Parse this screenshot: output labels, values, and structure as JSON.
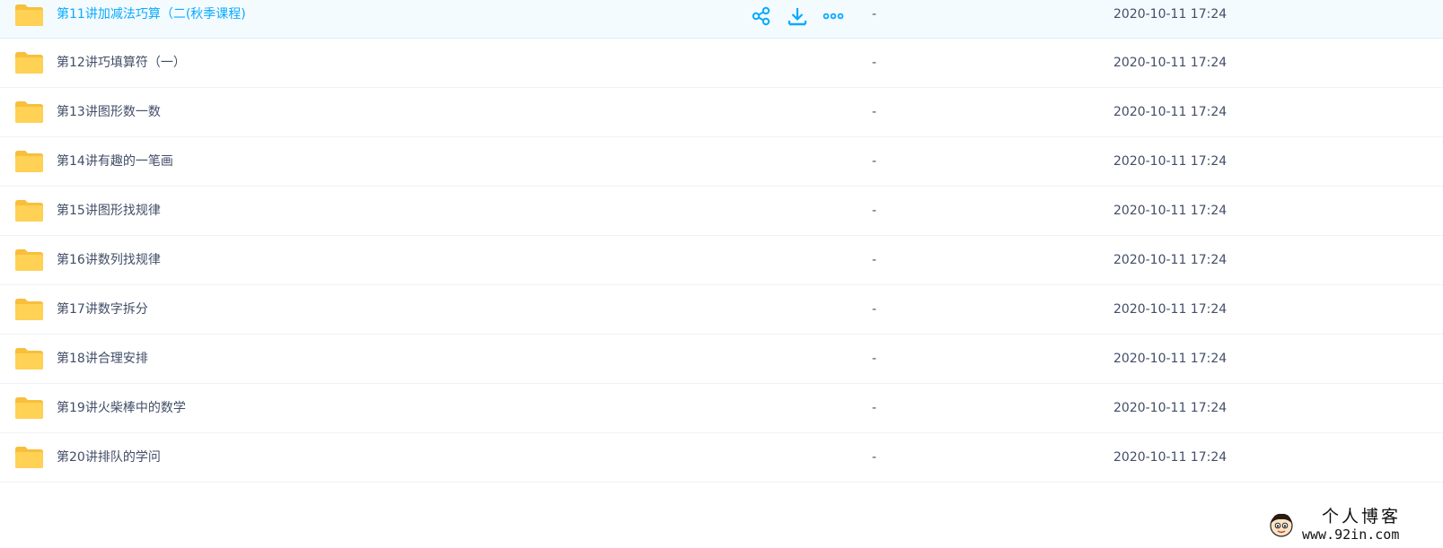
{
  "file_list": {
    "rows": [
      {
        "name": "第11讲加减法巧算（二(秋季课程)",
        "size": "-",
        "modified": "2020-10-11 17:24",
        "hovered": true
      },
      {
        "name": "第12讲巧填算符（一）",
        "size": "-",
        "modified": "2020-10-11 17:24",
        "hovered": false
      },
      {
        "name": "第13讲图形数一数",
        "size": "-",
        "modified": "2020-10-11 17:24",
        "hovered": false
      },
      {
        "name": "第14讲有趣的一笔画",
        "size": "-",
        "modified": "2020-10-11 17:24",
        "hovered": false
      },
      {
        "name": "第15讲图形找规律",
        "size": "-",
        "modified": "2020-10-11 17:24",
        "hovered": false
      },
      {
        "name": "第16讲数列找规律",
        "size": "-",
        "modified": "2020-10-11 17:24",
        "hovered": false
      },
      {
        "name": "第17讲数字拆分",
        "size": "-",
        "modified": "2020-10-11 17:24",
        "hovered": false
      },
      {
        "name": "第18讲合理安排",
        "size": "-",
        "modified": "2020-10-11 17:24",
        "hovered": false
      },
      {
        "name": "第19讲火柴棒中的数学",
        "size": "-",
        "modified": "2020-10-11 17:24",
        "hovered": false
      },
      {
        "name": "第20讲排队的学问",
        "size": "-",
        "modified": "2020-10-11 17:24",
        "hovered": false
      }
    ],
    "row_icon": "folder-icon",
    "hover_actions": [
      "share-icon",
      "download-icon",
      "more-icon"
    ]
  },
  "watermark": {
    "title": "个人博客",
    "url": "www.92in.com",
    "avatar_icon": "cartoon-avatar-icon"
  },
  "colors": {
    "accent": "#09aaff",
    "text": "#424e67",
    "folder": "#ffd154",
    "folder_tab": "#f7bf3c",
    "hover_bg": "#f4fbff",
    "divider": "#f0f2f5"
  }
}
